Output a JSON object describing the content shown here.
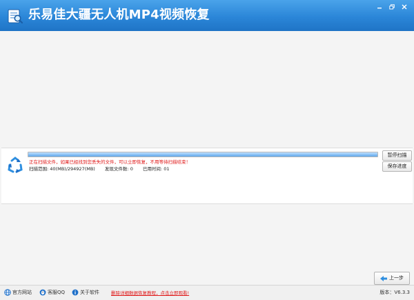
{
  "window": {
    "title": "乐易佳大疆无人机MP4视频恢复",
    "controls": [
      "minimize",
      "restore",
      "close"
    ]
  },
  "scan": {
    "progress_fraction": 1.0,
    "status_text": "正在扫描文件，如果已经找到您丢失的文件，可以立即恢复，不用等待扫描结束！",
    "range_label": "扫描范围:",
    "range_value": "40(MB)/294927(MB)",
    "found_label": "发现文件数:",
    "found_value": "0",
    "elapsed_label": "已用时间:",
    "elapsed_value": "01",
    "pause_button": "暂停扫描",
    "save_button": "保存进度"
  },
  "nav": {
    "prev_button": "上一步"
  },
  "statusbar": {
    "website": "官方网站",
    "qq": "客服QQ",
    "about": "关于软件",
    "tutorial_link": "删除详细数据恢复教程，点击立即观看!",
    "version_label": "版本：",
    "version_value": "V6.3.3"
  },
  "colors": {
    "title_bar": "#2b86d8",
    "status_red": "#e01818",
    "accent_blue": "#1e6fc8"
  }
}
